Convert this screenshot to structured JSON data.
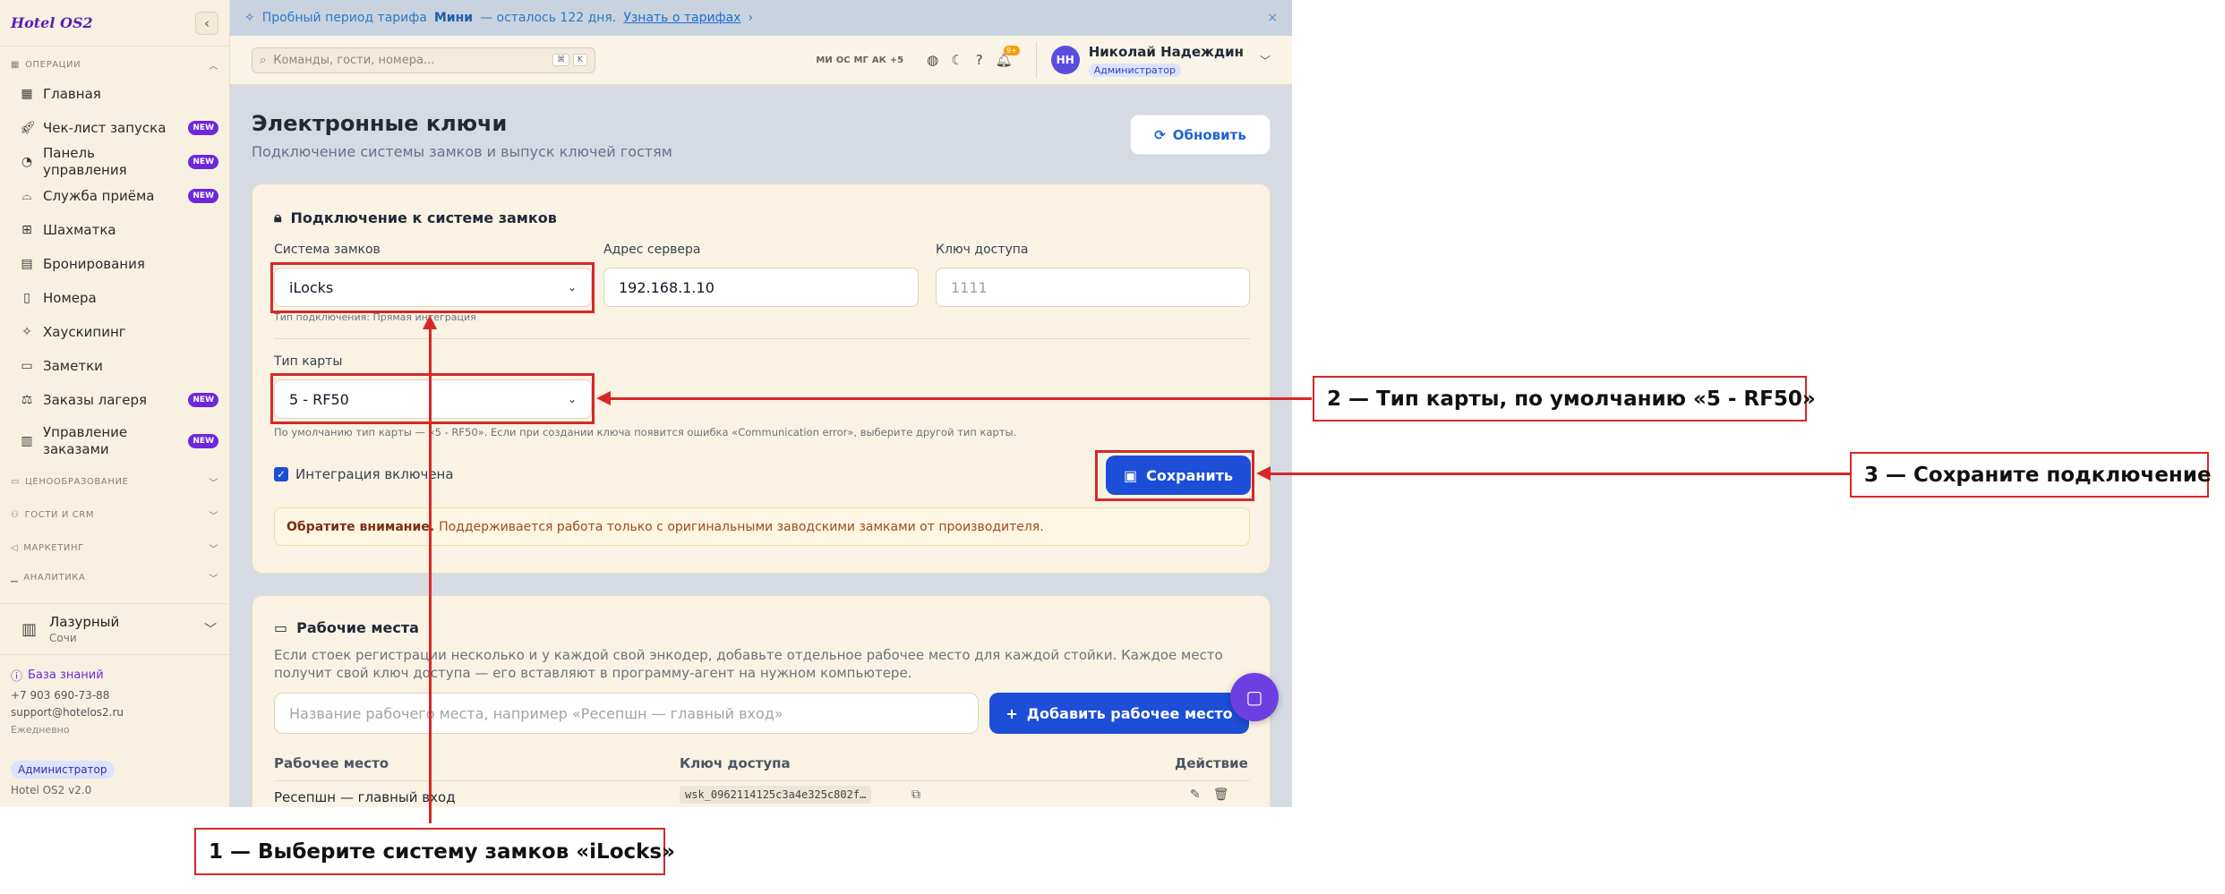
{
  "sidebar": {
    "logo": "Hotel OS2",
    "collapse_icon": "chevron-left-icon",
    "section_ops": "ОПЕРАЦИИ",
    "items": [
      {
        "label": "Главная",
        "icon": "grid-icon",
        "badge": ""
      },
      {
        "label": "Чек-лист запуска",
        "icon": "rocket-icon",
        "badge": "NEW"
      },
      {
        "label": "Панель управления",
        "icon": "gauge-icon",
        "badge": "NEW"
      },
      {
        "label": "Служба приёма",
        "icon": "bell-desk-icon",
        "badge": "NEW"
      },
      {
        "label": "Шахматка",
        "icon": "table-icon",
        "badge": ""
      },
      {
        "label": "Бронирования",
        "icon": "clipboard-icon",
        "badge": ""
      },
      {
        "label": "Номера",
        "icon": "door-icon",
        "badge": ""
      },
      {
        "label": "Хаускипинг",
        "icon": "sparkle-icon",
        "badge": ""
      },
      {
        "label": "Заметки",
        "icon": "note-icon",
        "badge": ""
      },
      {
        "label": "Заказы лагеря",
        "icon": "scale-icon",
        "badge": "NEW"
      },
      {
        "label": "Управление заказами",
        "icon": "receipt-icon",
        "badge": "NEW"
      }
    ],
    "sections_collapsed": [
      "ЦЕНООБРАЗОВАНИЕ",
      "ГОСТИ И CRM",
      "МАРКЕТИНГ",
      "АНАЛИТИКА"
    ],
    "hotel_name": "Лазурный",
    "hotel_city": "Сочи",
    "knowledge_base": "База знаний",
    "phone": "+7 903 690-73-88",
    "email": "support@hotelos2.ru",
    "schedule": "Ежедневно",
    "role": "Администратор",
    "version": "Hotel OS2 v2.0"
  },
  "trial": {
    "text_prefix": "Пробный период тарифа",
    "plan": "Мини",
    "text_suffix": "— осталось 122 дня.",
    "link": "Узнать о тарифах",
    "link_arrow": "›",
    "close": "×"
  },
  "topbar": {
    "search_placeholder": "Команды, гости, номера...",
    "kbd1": "⌘",
    "kbd2": "K",
    "avatars": [
      "МИ",
      "ОС",
      "МГ",
      "АК",
      "+5"
    ],
    "notifications_count": "9+",
    "user_initials": "НН",
    "user_name": "Николай Надеждин",
    "user_role": "Администратор"
  },
  "page": {
    "title": "Электронные ключи",
    "subtitle": "Подключение системы замков и выпуск ключей гостям",
    "refresh": "Обновить"
  },
  "connection": {
    "title": "Подключение к системе замков",
    "lock_system_label": "Система замков",
    "lock_system_value": "iLocks",
    "lock_system_hint": "Тип подключения: Прямая интеграция",
    "server_label": "Адрес сервера",
    "server_value": "192.168.1.10",
    "key_label": "Ключ доступа",
    "key_placeholder": "1111",
    "card_type_label": "Тип карты",
    "card_type_value": "5 - RF50",
    "card_type_hint": "По умолчанию тип карты — «5 - RF50». Если при создании ключа появится ошибка «Communication error», выберите другой тип карты.",
    "integration_label": "Интеграция включена",
    "save": "Сохранить",
    "warn_bold": "Обратите внимание.",
    "warn_text": "Поддерживается работа только с оригинальными заводскими замками от производителя."
  },
  "workplaces": {
    "title": "Рабочие места",
    "description": "Если стоек регистрации несколько и у каждой свой энкодер, добавьте отдельное рабочее место для каждой стойки. Каждое место получит свой ключ доступа — его вставляют в программу-агент на нужном компьютере.",
    "input_placeholder": "Название рабочего места, например «Ресепшн — главный вход»",
    "add_button": "Добавить рабочее место",
    "col_place": "Рабочее место",
    "col_key": "Ключ доступа",
    "col_action": "Действие",
    "rows": [
      {
        "place": "Ресепшн — главный вход",
        "key": "wsk_0962114125c3a4e325c802f…"
      }
    ]
  },
  "callouts": {
    "c1": "1 — Выберите систему замков «iLocks»",
    "c2": "2 — Тип карты, по умолчанию «5 - RF50»",
    "c3": "3 — Сохраните подключение"
  },
  "colors": {
    "accent": "#1d4ed8",
    "callout_red": "#d62828",
    "brand_purple": "#6d28d9"
  }
}
